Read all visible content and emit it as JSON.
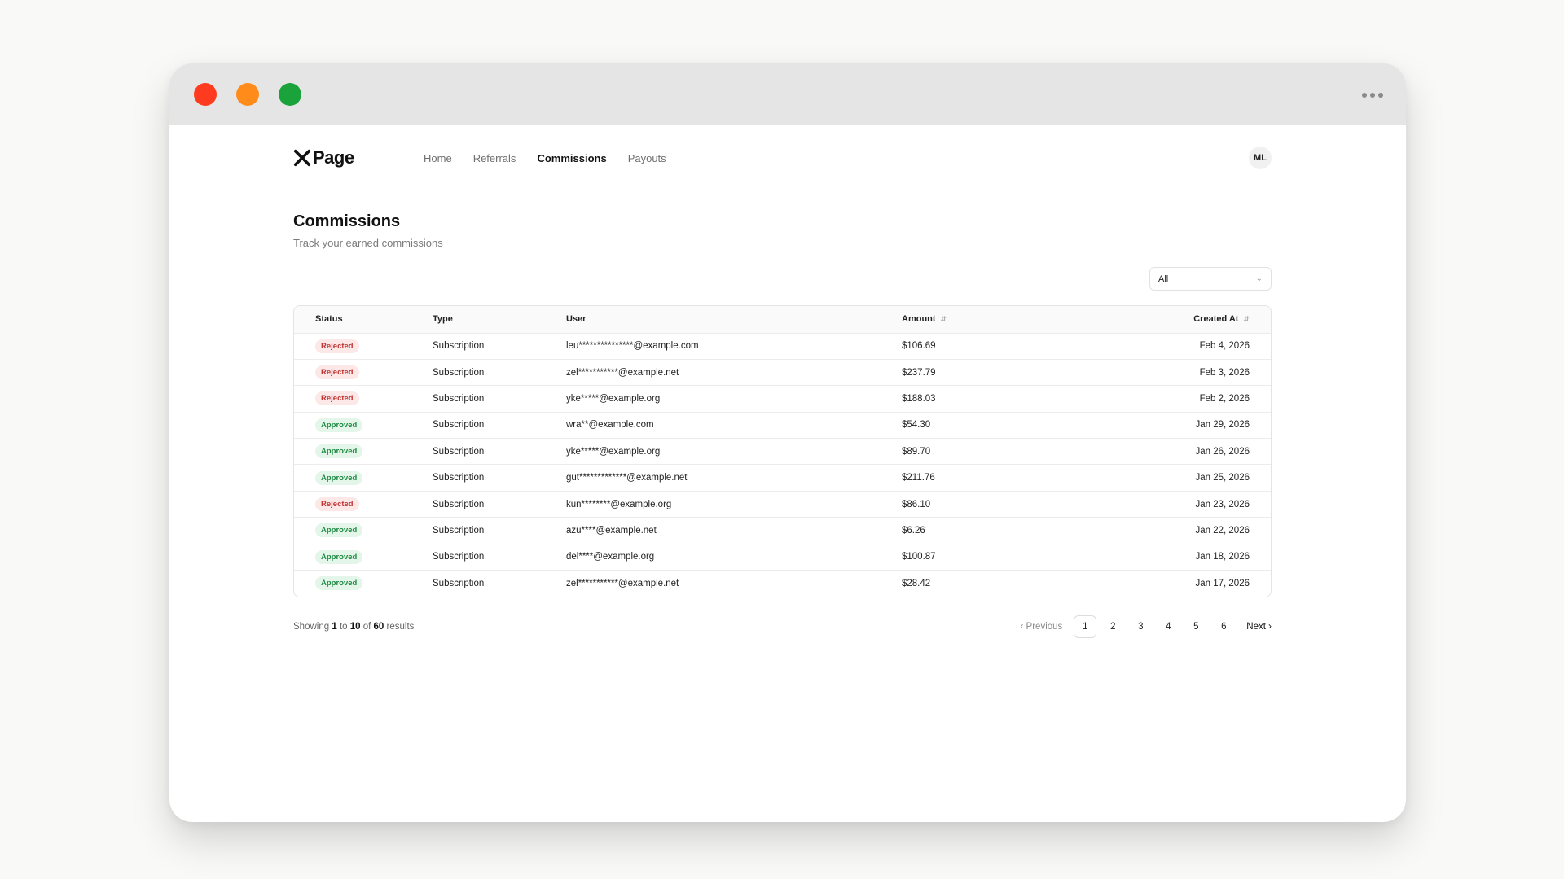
{
  "window": {
    "more_glyph": "•••"
  },
  "brand": {
    "name": "Page"
  },
  "nav": {
    "items": [
      {
        "label": "Home",
        "active": false
      },
      {
        "label": "Referrals",
        "active": false
      },
      {
        "label": "Commissions",
        "active": true
      },
      {
        "label": "Payouts",
        "active": false
      }
    ],
    "avatar": "ML"
  },
  "page": {
    "title": "Commissions",
    "subtitle": "Track your earned commissions"
  },
  "filter": {
    "value": "All",
    "icon": "chevron-down-icon"
  },
  "table": {
    "columns": {
      "status": "Status",
      "type": "Type",
      "user": "User",
      "amount": "Amount",
      "created": "Created At"
    },
    "rows": [
      {
        "status": "Rejected",
        "type": "Subscription",
        "user": "leu***************@example.com",
        "amount": "$106.69",
        "created": "Feb 4, 2026"
      },
      {
        "status": "Rejected",
        "type": "Subscription",
        "user": "zel***********@example.net",
        "amount": "$237.79",
        "created": "Feb 3, 2026"
      },
      {
        "status": "Rejected",
        "type": "Subscription",
        "user": "yke*****@example.org",
        "amount": "$188.03",
        "created": "Feb 2, 2026"
      },
      {
        "status": "Approved",
        "type": "Subscription",
        "user": "wra**@example.com",
        "amount": "$54.30",
        "created": "Jan 29, 2026"
      },
      {
        "status": "Approved",
        "type": "Subscription",
        "user": "yke*****@example.org",
        "amount": "$89.70",
        "created": "Jan 26, 2026"
      },
      {
        "status": "Approved",
        "type": "Subscription",
        "user": "gut*************@example.net",
        "amount": "$211.76",
        "created": "Jan 25, 2026"
      },
      {
        "status": "Rejected",
        "type": "Subscription",
        "user": "kun********@example.org",
        "amount": "$86.10",
        "created": "Jan 23, 2026"
      },
      {
        "status": "Approved",
        "type": "Subscription",
        "user": "azu****@example.net",
        "amount": "$6.26",
        "created": "Jan 22, 2026"
      },
      {
        "status": "Approved",
        "type": "Subscription",
        "user": "del****@example.org",
        "amount": "$100.87",
        "created": "Jan 18, 2026"
      },
      {
        "status": "Approved",
        "type": "Subscription",
        "user": "zel***********@example.net",
        "amount": "$28.42",
        "created": "Jan 17, 2026"
      }
    ]
  },
  "footer": {
    "showing_prefix": "Showing",
    "from": "1",
    "to_word": "to",
    "to": "10",
    "of_word": "of",
    "total": "60",
    "suffix": "results"
  },
  "pagination": {
    "previous": "Previous",
    "next": "Next",
    "pages": [
      "1",
      "2",
      "3",
      "4",
      "5",
      "6"
    ],
    "current": "1"
  },
  "colors": {
    "rejected_bg": "#fde8e8",
    "rejected_text": "#c03737",
    "approved_bg": "#e4f6e9",
    "approved_text": "#1f8a43"
  }
}
